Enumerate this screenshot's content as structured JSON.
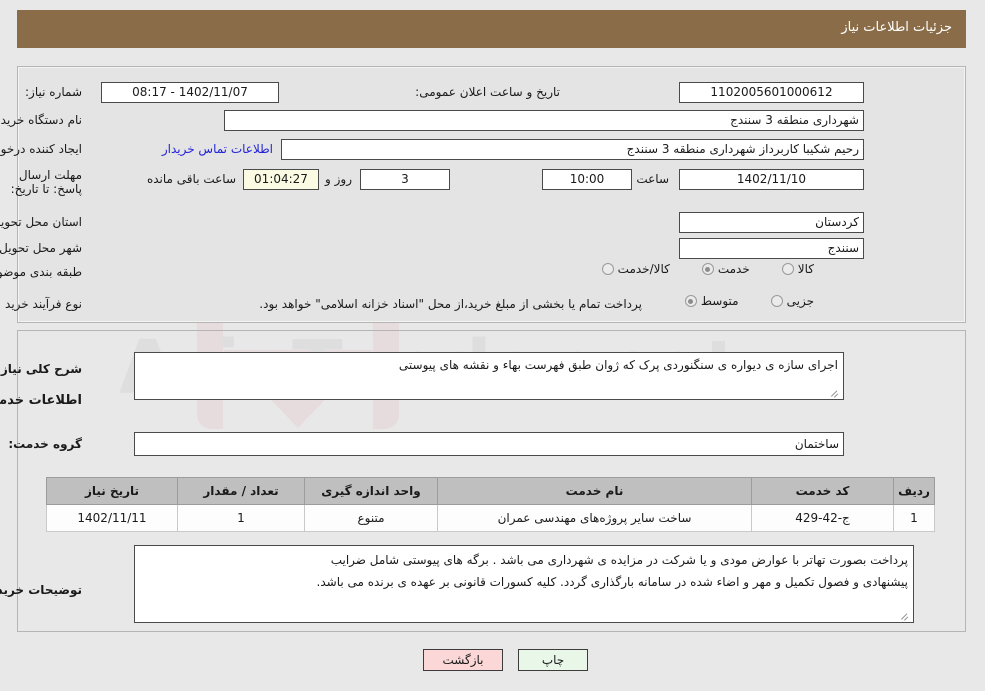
{
  "header": {
    "title": "جزئیات اطلاعات نیاز"
  },
  "colors": {
    "header_bg": "#8a6d48",
    "link": "#2323d8",
    "timer_bg": "#fbfbe4",
    "print_btn_bg": "#e9f7e9",
    "back_btn_bg": "#fbd7d7",
    "table_header_bg": "#bfbfbf"
  },
  "watermark": {
    "text": "AriaTender.net"
  },
  "top_form": {
    "need_number_label": "شماره نیاز:",
    "need_number_value": "1102005601000612",
    "announce_datetime_label": "تاریخ و ساعت اعلان عمومی:",
    "announce_datetime_value": "1402/11/07 - 08:17",
    "buyer_org_label": "نام دستگاه خریدار:",
    "buyer_org_value": "شهرداری منطقه 3 سنندج",
    "requester_label": "ایجاد کننده درخواست:",
    "requester_value": "رحیم شکیبا کاربرداز شهرداری منطقه 3 سنندج",
    "buyer_contact_link": "اطلاعات تماس خریدار",
    "deadline_label": "مهلت ارسال پاسخ: تا تاریخ:",
    "deadline_date": "1402/11/10",
    "deadline_hour_label": "ساعت",
    "deadline_hour_value": "10:00",
    "remaining_days_value": "3",
    "remaining_days_label": "روز و",
    "remaining_timer_value": "01:04:27",
    "remaining_timer_label": "ساعت باقی مانده",
    "province_label": "استان محل تحویل:",
    "province_value": "کردستان",
    "city_label": "شهر محل تحویل:",
    "city_value": "سنندج",
    "category_label": "طبقه بندی موضوعی:",
    "category_options": [
      {
        "label": "کالا",
        "selected": false
      },
      {
        "label": "خدمت",
        "selected": true
      },
      {
        "label": "کالا/خدمت",
        "selected": false
      }
    ],
    "process_type_label": "نوع فرآیند خرید :",
    "process_type_options": [
      {
        "label": "جزیی",
        "selected": false
      },
      {
        "label": "متوسط",
        "selected": true
      }
    ],
    "payment_note": "پرداخت تمام یا بخشی از مبلغ خرید،از محل \"اسناد خزانه اسلامی\" خواهد بود."
  },
  "description_section": {
    "general_desc_label": "شرح کلی نیاز:",
    "general_desc_value": "اجرای سازه ی دیواره ی سنگنوردی پرک که ژوان طبق فهرست بهاء و نقشه های پیوستی",
    "services_heading": "اطلاعات خدمات مورد نیاز",
    "service_group_label": "گروه خدمت:",
    "service_group_value": "ساختمان"
  },
  "table": {
    "columns": [
      "ردیف",
      "کد خدمت",
      "نام خدمت",
      "واحد اندازه گیری",
      "تعداد / مقدار",
      "تاریخ نیاز"
    ],
    "rows": [
      {
        "row_no": "1",
        "service_code": "ج-42-429",
        "service_name": "ساخت سایر پروژه‌های مهندسی عمران",
        "unit": "متنوع",
        "quantity": "1",
        "need_date": "1402/11/11"
      }
    ]
  },
  "buyer_notes": {
    "label": "توضیحات خریدار:",
    "line1": "پرداخت بصورت تهاتر با عوارض مودی و یا شرکت در مزایده ی شهرداری می باشد . برگه های پیوستی شامل ضرایب",
    "line2": "پیشنهادی و فصول تکمیل و مهر و اضاء شده در سامانه بارگذاری گردد. کلیه کسورات قانونی بر عهده ی برنده می باشد."
  },
  "footer": {
    "print_label": "چاپ",
    "back_label": "بازگشت"
  }
}
